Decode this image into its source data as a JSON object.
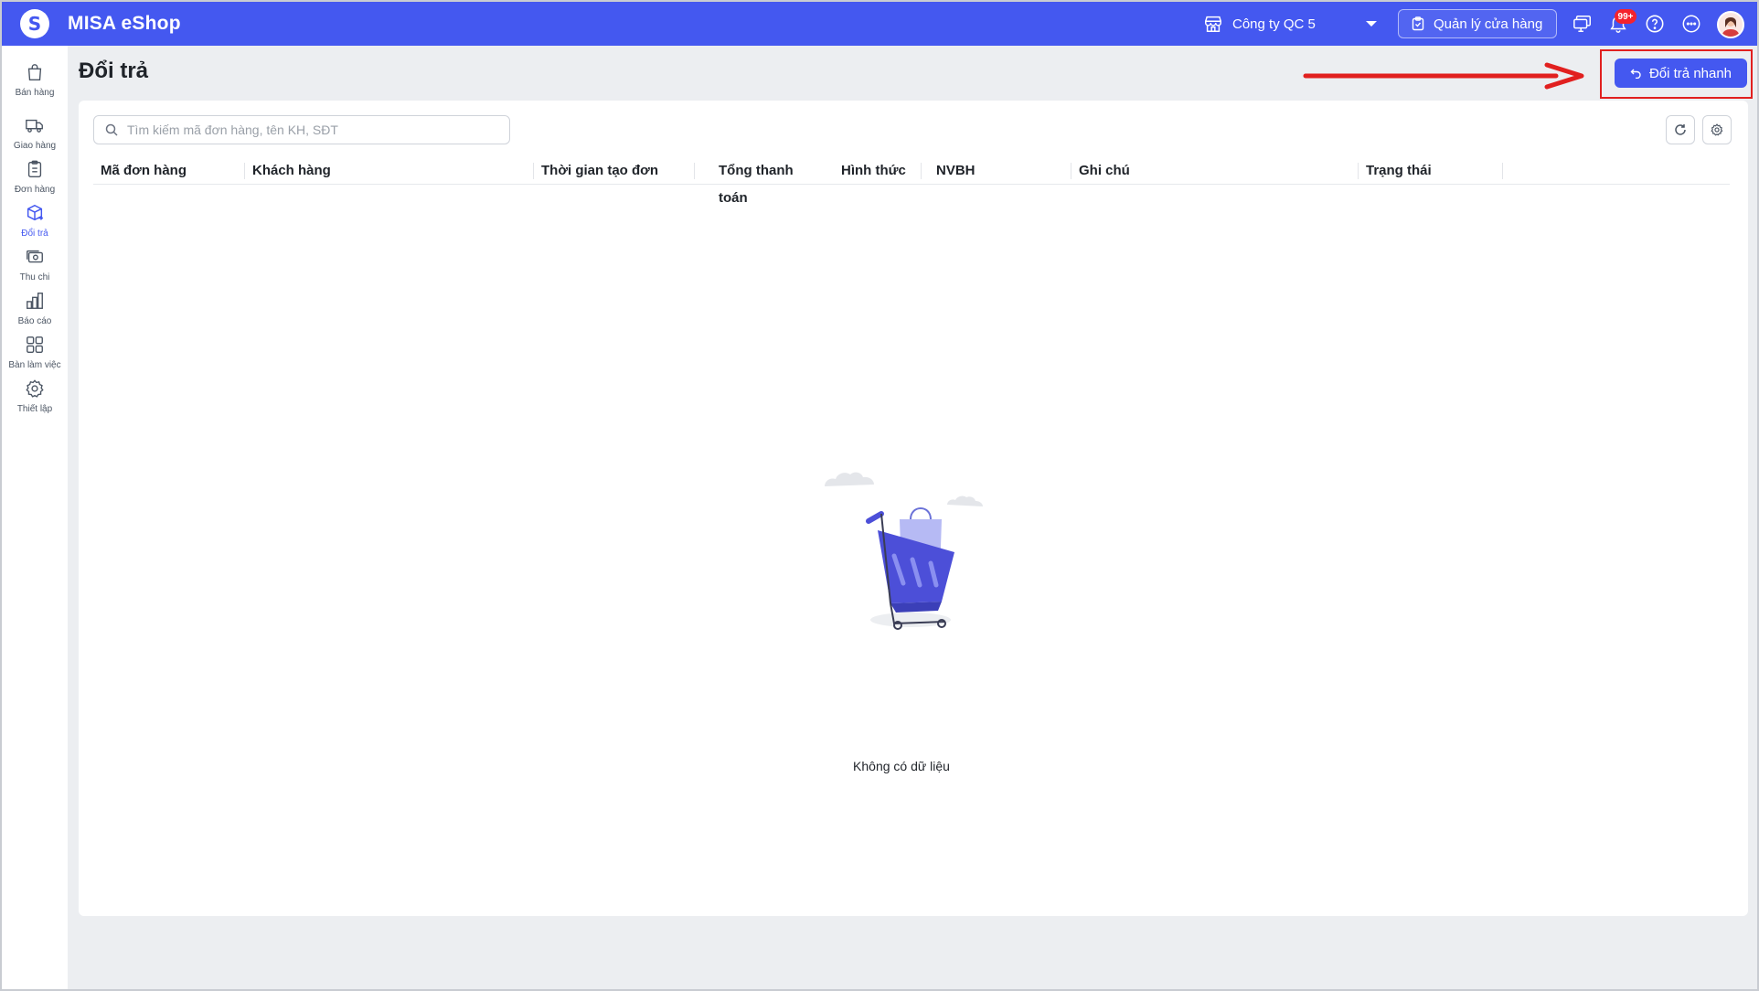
{
  "app": {
    "title": "MISA eShop",
    "logo_letter": "S"
  },
  "topbar": {
    "store_name": "Công ty QC 5",
    "manage_label": "Quản lý cửa hàng",
    "notification_count": "99+",
    "icons": [
      "store-icon",
      "clipboard-icon",
      "monitor-icon",
      "bell-icon",
      "help-icon",
      "more-icon",
      "avatar"
    ]
  },
  "sidebar": {
    "items": [
      {
        "label": "Bán hàng",
        "icon": "shopping-bag-icon",
        "active": false
      },
      {
        "label": "Giao hàng",
        "icon": "truck-icon",
        "active": false
      },
      {
        "label": "Đơn hàng",
        "icon": "clipboard-list-icon",
        "active": false
      },
      {
        "label": "Đổi trả",
        "icon": "return-box-icon",
        "active": true
      },
      {
        "label": "Thu chi",
        "icon": "cash-icon",
        "active": false
      },
      {
        "label": "Báo cáo",
        "icon": "bar-chart-icon",
        "active": false
      },
      {
        "label": "Bàn làm việc",
        "icon": "grid-icon",
        "active": false
      },
      {
        "label": "Thiết lập",
        "icon": "gear-icon",
        "active": false
      }
    ]
  },
  "page": {
    "title": "Đổi trả",
    "quick_return_label": "Đổi trả nhanh"
  },
  "search": {
    "placeholder": "Tìm kiếm mã đơn hàng, tên KH, SĐT",
    "value": ""
  },
  "table": {
    "columns": [
      "Mã đơn hàng",
      "Khách hàng",
      "Thời gian tạo đơn",
      "Tổng thanh toán",
      "Hình thức",
      "NVBH",
      "Ghi chú",
      "Trạng thái"
    ],
    "rows": []
  },
  "empty_state": {
    "text": "Không có dữ liệu"
  },
  "colors": {
    "primary": "#4458f0",
    "highlight": "#e1201f",
    "background": "#eceef1"
  }
}
